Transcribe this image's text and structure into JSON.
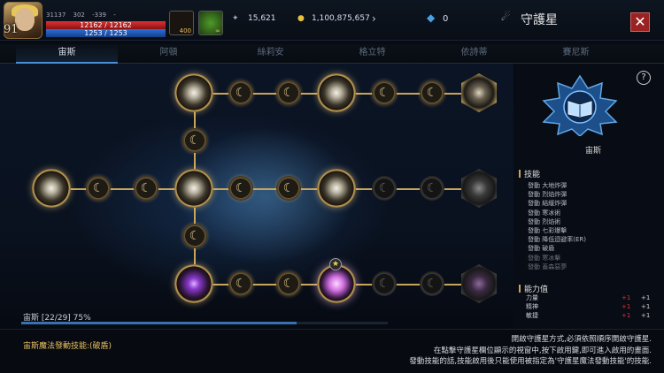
{
  "header": {
    "level": "91",
    "stat_a": "31137",
    "stat_b": "302",
    "stat_c": "-339",
    "stat_d": "-",
    "hp": "12162 / 12162",
    "mp": "1253 / 1253",
    "item1_count": "400",
    "item2_count": "∞",
    "currency1": "15,621",
    "currency2": "1,100,875,657",
    "currency3": "0",
    "title": "守護星",
    "close": "✕"
  },
  "tabs": [
    "宙斯",
    "阿頓",
    "絲莉安",
    "格立特",
    "依詩蒂",
    "賽尼斯"
  ],
  "progress": {
    "label": "宙斯 [22/29] 75%",
    "ratio": 0.75
  },
  "constellation": {
    "name": "宙斯"
  },
  "skills": {
    "header": "技能",
    "items": [
      {
        "text": "發動 大地炸彈",
        "dim": false
      },
      {
        "text": "發動 烈焰炸彈",
        "dim": false
      },
      {
        "text": "發動 結緩炸彈",
        "dim": false
      },
      {
        "text": "發動 寒冰術",
        "dim": false
      },
      {
        "text": "發動 烈焰術",
        "dim": false
      },
      {
        "text": "發動 七彩爆擊",
        "dim": false
      },
      {
        "text": "發動 降低迴避率(ER)",
        "dim": false
      },
      {
        "text": "發動 破盾",
        "dim": false
      },
      {
        "text": "發動 寒冰擊",
        "dim": true
      },
      {
        "text": "發動 蓋森惡夢",
        "dim": true
      }
    ]
  },
  "abilities": {
    "header": "能力值",
    "rows": [
      {
        "name": "力量",
        "v1": "+1",
        "v2": "+1"
      },
      {
        "name": "精神",
        "v1": "+1",
        "v2": "+1"
      },
      {
        "name": "敏捷",
        "v1": "+1",
        "v2": "+1"
      }
    ]
  },
  "footer": {
    "left": "宙斯魔法發動技能:(破盾)",
    "line1": "開啟守護星方式,必須依照順序開啟守護星.",
    "line2": "在點擊守護星欄位顯示的視窗中,按下啟用鍵,即可進入啟用的畫面.",
    "line3": "發動技能的話,技能啟用後只能使用被指定為'守護星魔法發動技能'的技能."
  },
  "help": "?",
  "colors": {
    "accent": "#c9a55a",
    "tab_active": "#4a90d9",
    "hp": "#d33333",
    "mp": "#2b6fd9"
  }
}
